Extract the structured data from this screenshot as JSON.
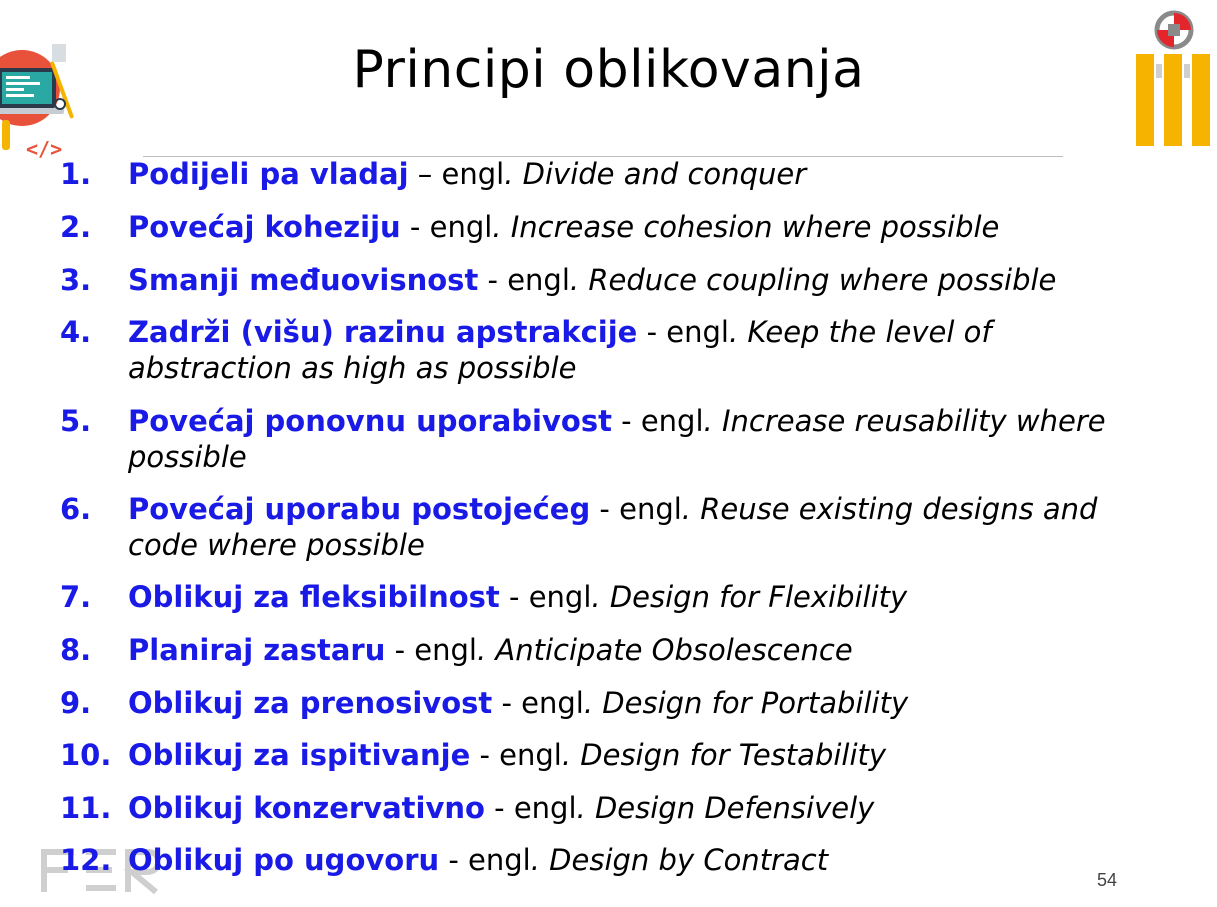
{
  "slide": {
    "title": "Principi oblikovanja",
    "page_number": "54",
    "separator_label": "engl",
    "items": [
      {
        "num": "1.",
        "term": "Podijeli pa vladaj",
        "sep": " – engl",
        "english": ". Divide and conquer"
      },
      {
        "num": "2.",
        "term": "Povećaj koheziju",
        "sep": " - engl",
        "english": ". Increase cohesion where possible"
      },
      {
        "num": "3.",
        "term": "Smanji međuovisnost",
        "sep": " - engl",
        "english": ". Reduce coupling where possible"
      },
      {
        "num": "4.",
        "term": "Zadrži (višu) razinu apstrakcije",
        "sep": " - engl",
        "english": ". Keep the level of abstraction as high as possible"
      },
      {
        "num": "5.",
        "term": "Povećaj ponovnu uporabivost",
        "sep": " - engl",
        "english": ". Increase reusability where possible"
      },
      {
        "num": "6.",
        "term": "Povećaj uporabu postojećeg",
        "sep": " - engl",
        "english": ". Reuse existing designs and code where possible"
      },
      {
        "num": "7.",
        "term": "Oblikuj za fleksibilnost",
        "sep": " - engl",
        "english": ". Design for Flexibility"
      },
      {
        "num": "8.",
        "term": "Planiraj zastaru",
        "sep": " - engl",
        "english": ". Anticipate Obsolescence"
      },
      {
        "num": "9.",
        "term": "Oblikuj za prenosivost",
        "sep": " - engl",
        "english": ". Design for Portability"
      },
      {
        "num": "10.",
        "term": "Oblikuj za ispitivanje",
        "sep": " - engl",
        "english": ". Design for Testability"
      },
      {
        "num": "11.",
        "term": "Oblikuj konzervativno",
        "sep": " - engl",
        "english": ". Design Defensively"
      },
      {
        "num": "12.",
        "term": "Oblikuj po ugovoru",
        "sep": " - engl",
        "english": ". Design by Contract"
      }
    ]
  },
  "icons": {
    "left": "laptop-code-illustration-icon",
    "right": "fer-institution-logo-icon",
    "bottom": "fer-watermark-logo-icon"
  },
  "colors": {
    "term_blue": "#1a1ae6",
    "logo_orange": "#f6b400",
    "logo_red": "#e3262c"
  }
}
